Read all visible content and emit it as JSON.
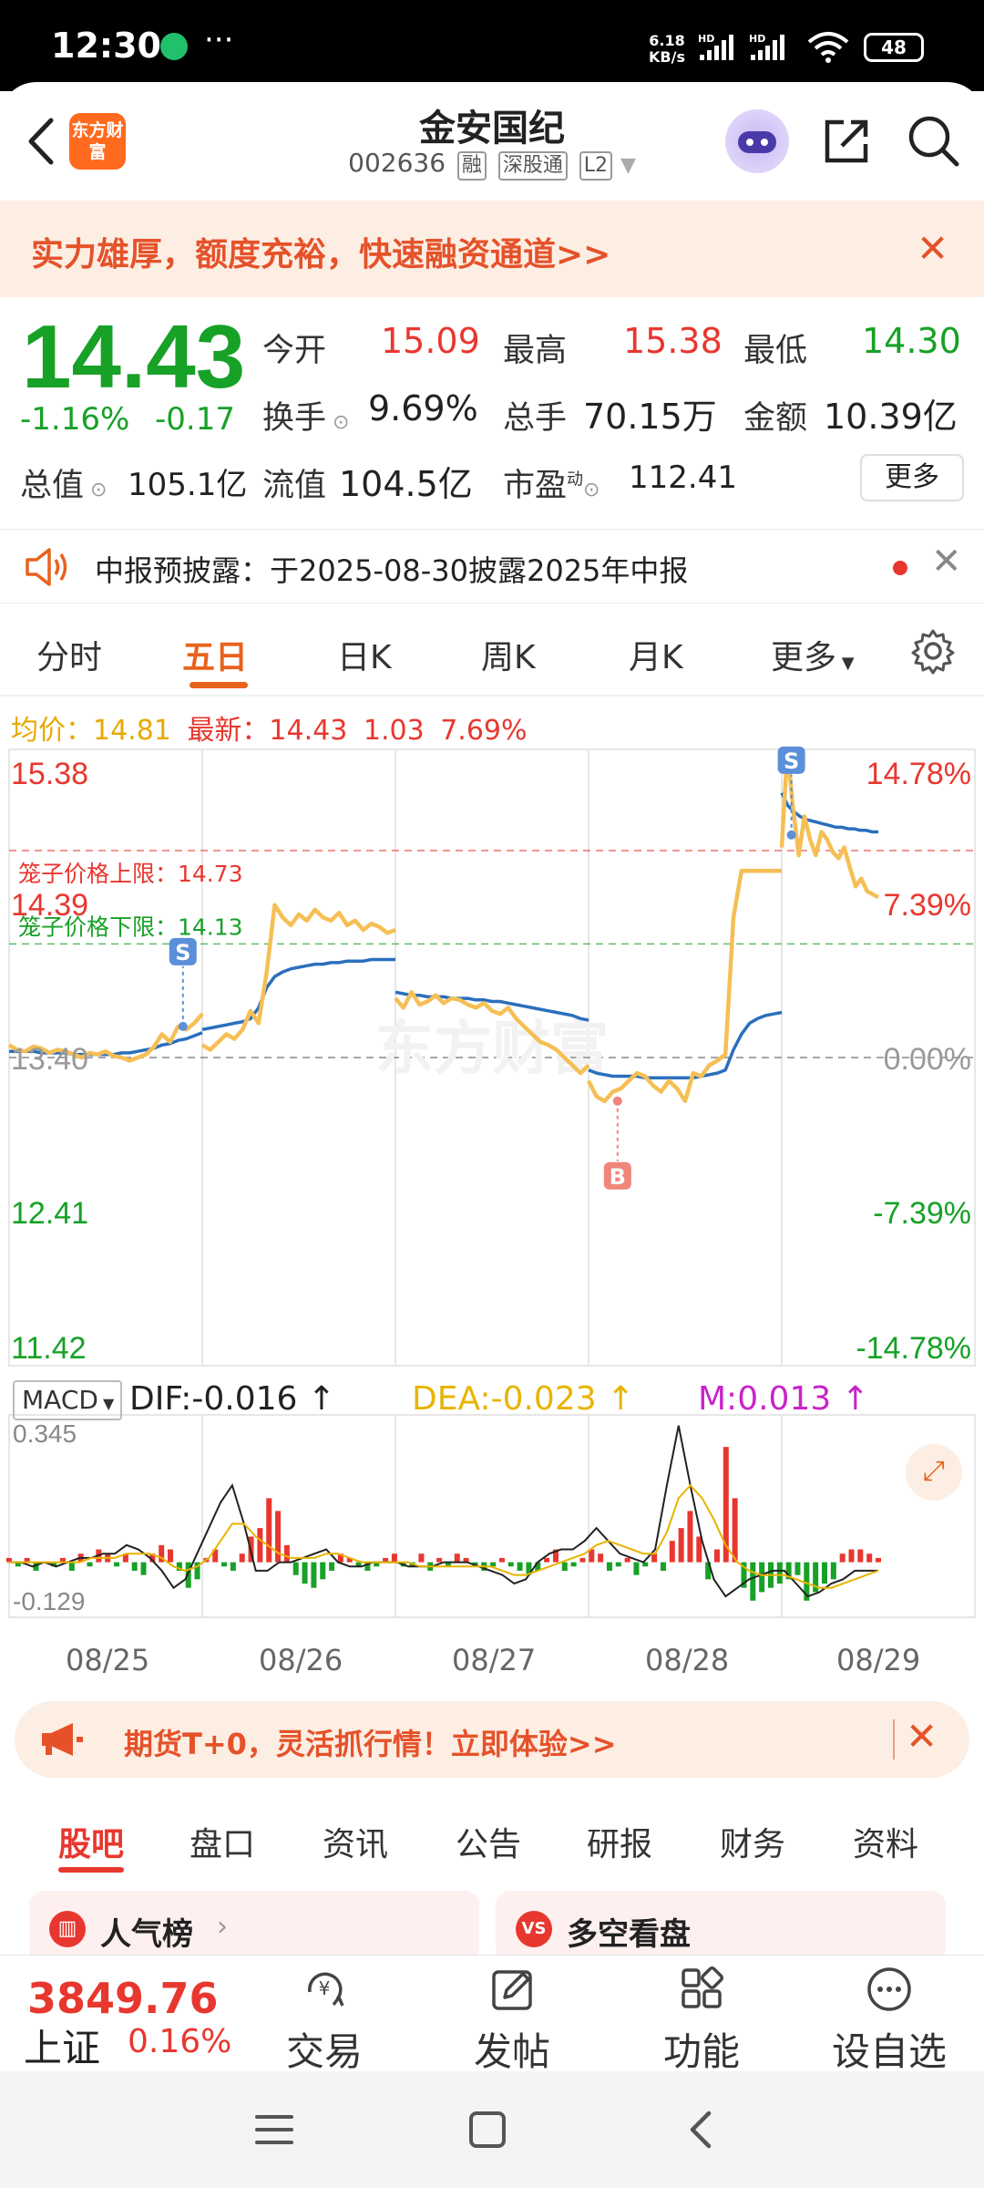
{
  "status_bar": {
    "time": "12:30",
    "net_speed_value": "6.18",
    "net_speed_unit": "KB/s",
    "sig_label": "HD",
    "battery": "48"
  },
  "header": {
    "logo_text": "东方财富",
    "stock_name": "金安国纪",
    "stock_code": "002636",
    "tags": [
      "融",
      "深股通",
      "L2"
    ]
  },
  "promo": {
    "text": "实力雄厚，额度充裕，快速融资通道>>"
  },
  "quote": {
    "price": "14.43",
    "change_pct": "-1.16%",
    "change_abs": "-0.17",
    "open_label": "今开",
    "open": "15.09",
    "high_label": "最高",
    "high": "15.38",
    "low_label": "最低",
    "low": "14.30",
    "turnover_label": "换手",
    "turnover": "9.69%",
    "volume_label": "总手",
    "volume": "70.15万",
    "amount_label": "金额",
    "amount": "10.39亿",
    "mktcap_label": "总值",
    "mktcap": "105.1亿",
    "float_label": "流值",
    "float": "104.5亿",
    "pe_label": "市盈",
    "pe_sup": "动",
    "pe": "112.41",
    "more_label": "更多"
  },
  "notice": {
    "text": "中报预披露：于2025-08-30披露2025年中报"
  },
  "chart_tabs": [
    "分时",
    "五日",
    "日K",
    "周K",
    "月K",
    "更多"
  ],
  "active_chart_tab": "五日",
  "chart_info": {
    "avg_label": "均价：14.81",
    "latest_label": "最新：14.43",
    "change": "1.03",
    "pct": "7.69%"
  },
  "chart_data": {
    "type": "line",
    "y_labels_left": [
      "15.38",
      "14.39",
      "13.40",
      "12.41",
      "11.42"
    ],
    "y_labels_right": [
      "14.78%",
      "7.39%",
      "0.00%",
      "-7.39%",
      "-14.78%"
    ],
    "ylim": [
      11.42,
      15.38
    ],
    "prev_close": 13.4,
    "upper_limit_label": "笼子价格上限：14.73",
    "upper_limit": 14.73,
    "lower_limit_label": "笼子价格下限：14.13",
    "lower_limit": 14.13,
    "watermark": "东方财富",
    "markers": [
      {
        "label": "S",
        "day": 0,
        "t": 0.9,
        "price": 13.6
      },
      {
        "label": "B",
        "day": 3,
        "t": 0.15,
        "price": 13.12
      },
      {
        "label": "S",
        "day": 4,
        "t": 0.05,
        "price": 14.83
      }
    ],
    "x_labels": [
      "08/25",
      "08/26",
      "08/27",
      "08/28",
      "08/29"
    ],
    "series": [
      {
        "values": [
          [
            13.48,
            13.45,
            13.44,
            13.47,
            13.46,
            13.43,
            13.45,
            13.44,
            13.42,
            13.4,
            13.43,
            13.42,
            13.44,
            13.41,
            13.4,
            13.38,
            13.4,
            13.42,
            13.47,
            13.55,
            13.5,
            13.6,
            13.58,
            13.62,
            13.68
          ],
          [
            13.48,
            13.45,
            13.5,
            13.55,
            13.52,
            13.58,
            13.7,
            13.62,
            13.95,
            14.38,
            14.3,
            14.25,
            14.32,
            14.28,
            14.35,
            14.3,
            14.28,
            14.33,
            14.25,
            14.28,
            14.22,
            14.26,
            14.24,
            14.2,
            14.22
          ],
          [
            13.78,
            13.72,
            13.82,
            13.74,
            13.76,
            13.8,
            13.75,
            13.78,
            13.77,
            13.74,
            13.72,
            13.75,
            13.7,
            13.68,
            13.72,
            13.65,
            13.6,
            13.55,
            13.5,
            13.48,
            13.45,
            13.4,
            13.35,
            13.3,
            13.35
          ],
          [
            13.25,
            13.15,
            13.12,
            13.18,
            13.2,
            13.25,
            13.3,
            13.28,
            13.22,
            13.18,
            13.25,
            13.2,
            13.12,
            13.3,
            13.28,
            13.35,
            13.38,
            13.42,
            14.3,
            14.6,
            14.6,
            14.6,
            14.6,
            14.6,
            14.6
          ],
          [
            14.75,
            15.38,
            15.0,
            14.7,
            14.95,
            14.8,
            14.7,
            14.85,
            14.8,
            14.72,
            14.68,
            14.75,
            14.62,
            14.5,
            14.55,
            14.47,
            14.45,
            14.43
          ]
        ]
      },
      {
        "values": [
          [
            13.44,
            13.44,
            13.44,
            13.44,
            13.43,
            13.43,
            13.43,
            13.43,
            13.42,
            13.42,
            13.42,
            13.42,
            13.42,
            13.42,
            13.43,
            13.43,
            13.44,
            13.45,
            13.46,
            13.48,
            13.49,
            13.51,
            13.52,
            13.54,
            13.56
          ],
          [
            13.58,
            13.59,
            13.6,
            13.61,
            13.62,
            13.63,
            13.65,
            13.72,
            13.85,
            13.92,
            13.95,
            13.97,
            13.98,
            13.99,
            14.0,
            14.0,
            14.01,
            14.01,
            14.02,
            14.02,
            14.02,
            14.03,
            14.03,
            14.03,
            14.03
          ],
          [
            13.82,
            13.81,
            13.8,
            13.8,
            13.79,
            13.79,
            13.79,
            13.78,
            13.78,
            13.78,
            13.77,
            13.77,
            13.76,
            13.76,
            13.75,
            13.74,
            13.73,
            13.72,
            13.71,
            13.7,
            13.69,
            13.68,
            13.67,
            13.65,
            13.64
          ],
          [
            13.32,
            13.3,
            13.29,
            13.28,
            13.28,
            13.28,
            13.28,
            13.27,
            13.27,
            13.27,
            13.27,
            13.27,
            13.27,
            13.27,
            13.28,
            13.29,
            13.3,
            13.32,
            13.45,
            13.55,
            13.62,
            13.65,
            13.67,
            13.68,
            13.69
          ],
          [
            15.1,
            15.02,
            14.98,
            14.95,
            14.93,
            14.92,
            14.91,
            14.9,
            14.89,
            14.88,
            14.88,
            14.87,
            14.87,
            14.86,
            14.86,
            14.85,
            14.85
          ]
        ]
      }
    ]
  },
  "macd": {
    "select_label": "MACD",
    "dif": "DIF:-0.016",
    "dea": "DEA:-0.023",
    "m": "M:0.013",
    "ymax_label": "0.345",
    "ymin_label": "-0.129",
    "ylim": [
      -0.129,
      0.345
    ],
    "bars": [
      0.01,
      -0.01,
      0.01,
      -0.02,
      0.0,
      -0.01,
      0.01,
      -0.02,
      0.02,
      -0.01,
      0.03,
      0.02,
      -0.01,
      0.02,
      -0.02,
      -0.03,
      0.02,
      0.04,
      0.03,
      -0.02,
      -0.06,
      -0.04,
      0.01,
      0.03,
      -0.01,
      -0.02,
      0.02,
      0.06,
      0.08,
      0.15,
      0.12,
      0.04,
      -0.03,
      -0.05,
      -0.06,
      -0.04,
      -0.02,
      0.02,
      0.01,
      -0.01,
      -0.02,
      -0.01,
      0.01,
      0.02,
      -0.01,
      -0.01,
      0.02,
      -0.02,
      0.01,
      -0.01,
      0.02,
      0.01,
      -0.01,
      -0.02,
      -0.01,
      0.01,
      -0.01,
      -0.02,
      -0.03,
      -0.02,
      0.01,
      0.03,
      -0.02,
      -0.01,
      0.01,
      0.03,
      0.02,
      -0.02,
      -0.01,
      0.01,
      -0.03,
      -0.01,
      0.02,
      -0.02,
      0.05,
      0.08,
      0.12,
      0.06,
      -0.04,
      0.03,
      0.27,
      0.15,
      -0.06,
      -0.09,
      -0.07,
      -0.06,
      -0.05,
      -0.04,
      -0.03,
      -0.09,
      -0.07,
      -0.05,
      -0.04,
      0.02,
      0.03,
      0.03,
      0.02,
      0.01
    ],
    "dif_values": [
      0.0,
      0.0,
      -0.01,
      0.0,
      -0.01,
      0.0,
      0.01,
      0.01,
      0.02,
      0.02,
      0.04,
      0.03,
      0.01,
      -0.02,
      -0.06,
      -0.04,
      0.02,
      0.08,
      0.14,
      0.18,
      0.09,
      -0.02,
      -0.02,
      0.0,
      0.0,
      0.01,
      0.02,
      0.03,
      0.0,
      -0.01,
      -0.01,
      0.0,
      0.0,
      0.0,
      -0.01,
      -0.01,
      -0.01,
      0.0,
      0.0,
      0.0,
      -0.01,
      -0.02,
      -0.03,
      -0.05,
      -0.04,
      0.0,
      0.02,
      0.03,
      0.03,
      0.05,
      0.08,
      0.05,
      0.02,
      0.01,
      0.0,
      0.03,
      0.18,
      0.32,
      0.18,
      0.05,
      -0.04,
      -0.08,
      -0.06,
      -0.04,
      -0.03,
      -0.02,
      -0.02,
      -0.05,
      -0.08,
      -0.07,
      -0.05,
      -0.04,
      -0.02,
      -0.02,
      -0.02
    ],
    "dea_values": [
      0.0,
      0.0,
      0.0,
      0.0,
      0.0,
      0.0,
      0.0,
      0.01,
      0.01,
      0.01,
      0.02,
      0.02,
      0.02,
      0.01,
      -0.01,
      -0.02,
      -0.01,
      0.01,
      0.05,
      0.09,
      0.09,
      0.06,
      0.04,
      0.02,
      0.01,
      0.01,
      0.01,
      0.02,
      0.02,
      0.01,
      0.0,
      0.0,
      0.0,
      0.0,
      0.0,
      -0.01,
      -0.01,
      -0.01,
      -0.01,
      -0.01,
      -0.01,
      -0.01,
      -0.02,
      -0.03,
      -0.03,
      -0.02,
      -0.01,
      0.0,
      0.01,
      0.02,
      0.04,
      0.05,
      0.04,
      0.03,
      0.02,
      0.02,
      0.07,
      0.15,
      0.18,
      0.15,
      0.1,
      0.04,
      0.0,
      -0.02,
      -0.03,
      -0.03,
      -0.03,
      -0.04,
      -0.05,
      -0.06,
      -0.06,
      -0.05,
      -0.04,
      -0.03,
      -0.02
    ]
  },
  "futures_banner": {
    "text": "期货T+0，灵活抓行情！立即体验>>"
  },
  "bottom_tabs": [
    "股吧",
    "盘口",
    "资讯",
    "公告",
    "研报",
    "财务",
    "资料"
  ],
  "cards": [
    {
      "label": "人气榜"
    },
    {
      "label": "多空看盘"
    }
  ],
  "footer": {
    "index_value": "3849.76",
    "index_name": "上证",
    "index_pct": "0.16%",
    "items": [
      "交易",
      "发帖",
      "功能",
      "设自选"
    ]
  },
  "colors": {
    "up": "#e8372f",
    "down": "#17a127",
    "price_line": "#2a6fbd",
    "avg_line": "#f5bf55",
    "accent": "#e8621c"
  }
}
